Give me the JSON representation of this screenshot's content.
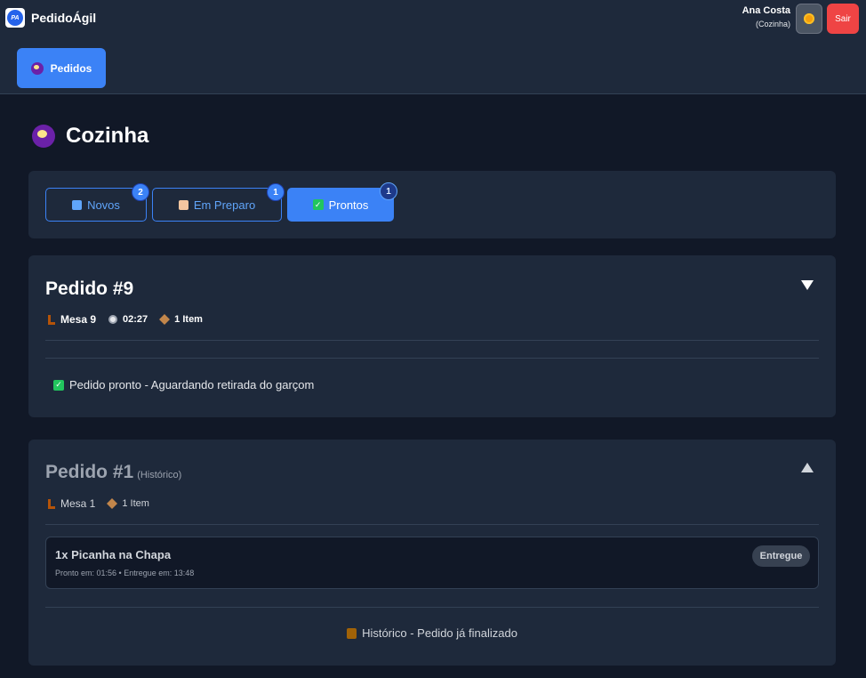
{
  "app": {
    "name": "PedidoÁgil",
    "logo_text": "PA"
  },
  "user": {
    "name": "Ana Costa",
    "role": "(Cozinha)"
  },
  "header": {
    "theme_icon": "sun-icon",
    "logout_label": "Sair"
  },
  "nav": {
    "items": [
      {
        "label": "Pedidos",
        "icon": "cooking-pot-icon",
        "active": true
      }
    ]
  },
  "page": {
    "title": "Cozinha",
    "icon": "cooking-pot-icon"
  },
  "tabs": [
    {
      "label": "Novos",
      "icon": "new-icon",
      "count": "2",
      "active": false
    },
    {
      "label": "Em Preparo",
      "icon": "cook-icon",
      "count": "1",
      "active": false
    },
    {
      "label": "Prontos",
      "icon": "check-icon",
      "count": "1",
      "active": true
    }
  ],
  "orders": [
    {
      "title": "Pedido #9",
      "subtitle": "",
      "expanded": true,
      "table": "Mesa 9",
      "time": "02:27",
      "items_count": "1 Item",
      "status_message": "Pedido pronto - Aguardando retirada do garçom"
    },
    {
      "title": "Pedido #1",
      "subtitle": "(Histórico)",
      "expanded": false,
      "table": "Mesa 1",
      "items_count": "1 Item",
      "items": [
        {
          "name": "1x Picanha na Chapa",
          "times": "Pronto em: 01:56 • Entregue em: 13:48",
          "status": "Entregue"
        }
      ],
      "history_message": "Histórico - Pedido já finalizado"
    }
  ],
  "colors": {
    "background": "#111827",
    "surface": "#1e293b",
    "accent": "#3b82f6",
    "danger": "#ef4444",
    "success": "#22c55e"
  }
}
